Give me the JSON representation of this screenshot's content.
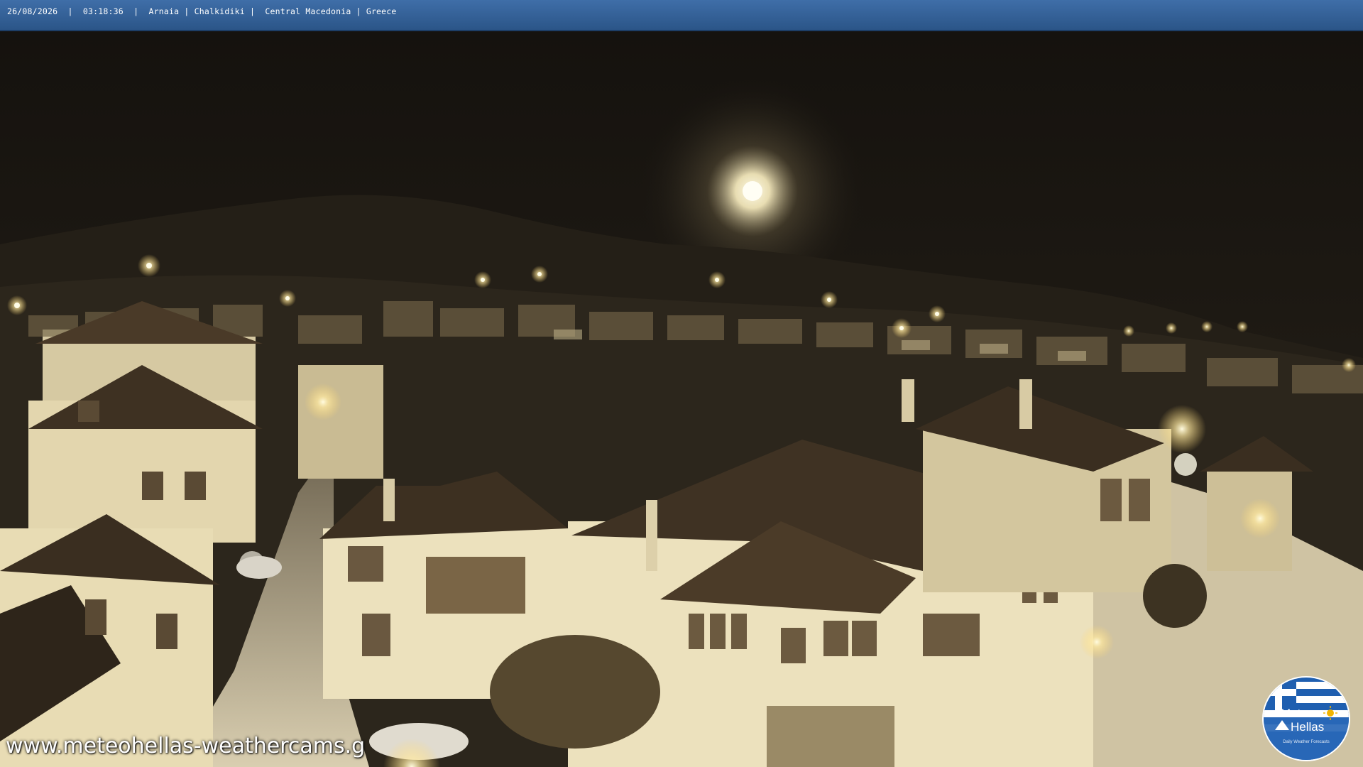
{
  "overlay": {
    "date": "26/08/2026",
    "time": "03:18:36",
    "location": "Arnaia | Chalkidiki |  Central Macedonia | Greece",
    "separator": "|"
  },
  "watermark": {
    "text": "www.meteohellas-weathercams.g"
  },
  "logo": {
    "line1": "Meteo",
    "line2": "Hellas",
    "tagline": "Daily Weather Forecasts",
    "sun_icon": "sun-icon",
    "colors": {
      "blue": "#1f5fb0",
      "white": "#ffffff",
      "sun": "#f2b400"
    }
  },
  "scene": {
    "description_icon": "night-village-scene",
    "colors": {
      "sky": "#1c1813",
      "lamp": "#fff6c8",
      "wall": "#e8dcb4",
      "roof": "#4a3a28"
    }
  }
}
